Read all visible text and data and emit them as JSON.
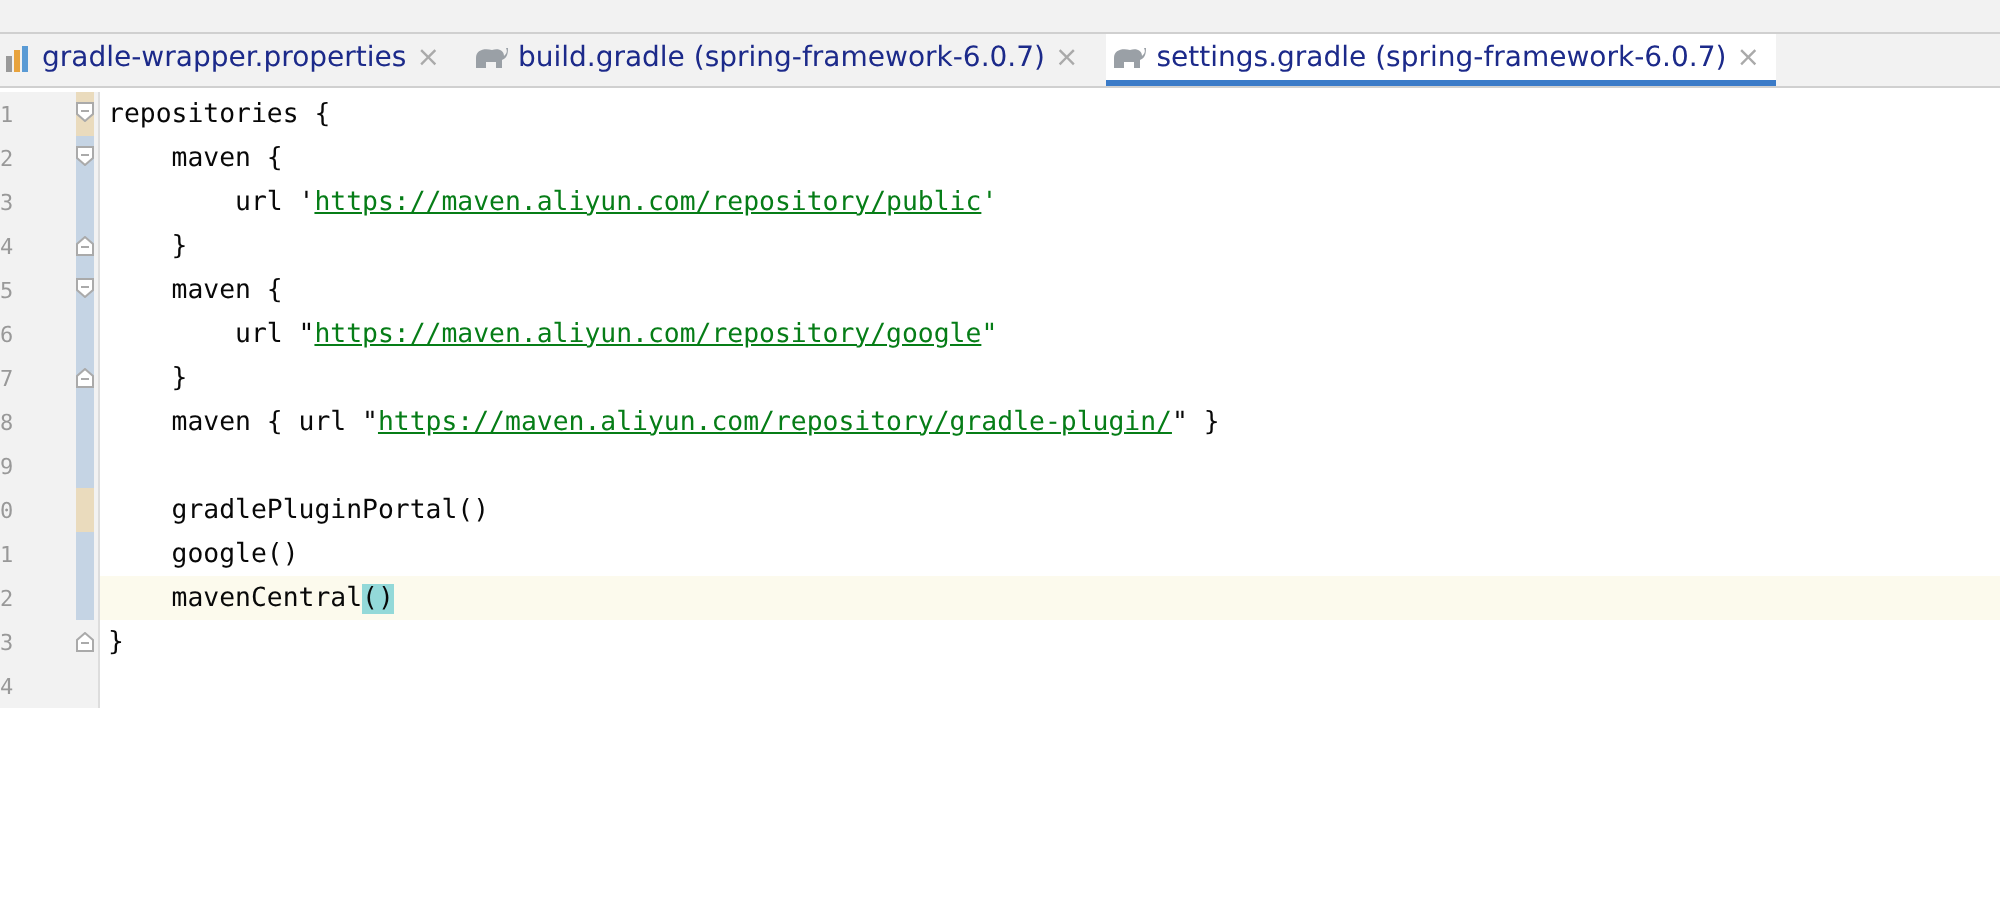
{
  "tabs": [
    {
      "label": "gradle-wrapper.properties",
      "kind": "properties",
      "selected": false,
      "close": "×"
    },
    {
      "label": "build.gradle (spring-framework-6.0.7)",
      "kind": "gradle",
      "selected": false,
      "close": "×"
    },
    {
      "label": "settings.gradle (spring-framework-6.0.7)",
      "kind": "gradle",
      "selected": true,
      "close": "×"
    }
  ],
  "lines": [
    {
      "number": "1",
      "added": true,
      "modified": false,
      "fold_start": true,
      "fold_end": false,
      "current": false,
      "segments": [
        {
          "kind": "code",
          "text": "repositories {"
        }
      ]
    },
    {
      "number": "2",
      "added": false,
      "modified": true,
      "fold_start": true,
      "fold_end": false,
      "current": false,
      "segments": [
        {
          "kind": "code",
          "text": "    maven {"
        }
      ]
    },
    {
      "number": "3",
      "added": false,
      "modified": true,
      "fold_start": false,
      "fold_end": false,
      "current": false,
      "segments": [
        {
          "kind": "code",
          "text": "        url '"
        },
        {
          "kind": "url",
          "text": "https://maven.aliyun.com/repository/public"
        },
        {
          "kind": "string",
          "text": "'"
        }
      ]
    },
    {
      "number": "4",
      "added": false,
      "modified": true,
      "fold_start": false,
      "fold_end": true,
      "current": false,
      "segments": [
        {
          "kind": "code",
          "text": "    }"
        }
      ]
    },
    {
      "number": "5",
      "added": false,
      "modified": true,
      "fold_start": true,
      "fold_end": false,
      "current": false,
      "segments": [
        {
          "kind": "code",
          "text": "    maven {"
        }
      ]
    },
    {
      "number": "6",
      "added": false,
      "modified": true,
      "fold_start": false,
      "fold_end": false,
      "current": false,
      "segments": [
        {
          "kind": "code",
          "text": "        url \""
        },
        {
          "kind": "url",
          "text": "https://maven.aliyun.com/repository/google"
        },
        {
          "kind": "string",
          "text": "\""
        }
      ]
    },
    {
      "number": "7",
      "added": false,
      "modified": true,
      "fold_start": false,
      "fold_end": true,
      "current": false,
      "segments": [
        {
          "kind": "code",
          "text": "    }"
        }
      ]
    },
    {
      "number": "8",
      "added": false,
      "modified": true,
      "fold_start": false,
      "fold_end": false,
      "current": false,
      "segments": [
        {
          "kind": "code",
          "text": "    maven { url \""
        },
        {
          "kind": "url",
          "text": "https://maven.aliyun.com/repository/gradle-plugin/"
        },
        {
          "kind": "code",
          "text": "\" }"
        }
      ]
    },
    {
      "number": "9",
      "added": false,
      "modified": true,
      "fold_start": false,
      "fold_end": false,
      "current": false
    },
    {
      "number": "0",
      "added": true,
      "modified": false,
      "fold_start": false,
      "fold_end": false,
      "current": false,
      "segments": [
        {
          "kind": "code",
          "text": "    gradlePluginPortal()"
        }
      ]
    },
    {
      "number": "1",
      "added": false,
      "modified": true,
      "fold_start": false,
      "fold_end": false,
      "current": false,
      "segments": [
        {
          "kind": "code",
          "text": "    google()"
        }
      ]
    },
    {
      "number": "2",
      "added": false,
      "modified": true,
      "fold_start": false,
      "fold_end": false,
      "current": true,
      "segments": [
        {
          "kind": "code",
          "text": "    mavenCentral"
        },
        {
          "kind": "bracket",
          "text": "()"
        }
      ]
    },
    {
      "number": "3",
      "added": false,
      "modified": false,
      "fold_start": false,
      "fold_end": true,
      "current": false,
      "segments": [
        {
          "kind": "code",
          "text": "}"
        }
      ]
    },
    {
      "number": "4",
      "added": false,
      "modified": false,
      "fold_start": false,
      "fold_end": false,
      "current": false
    }
  ]
}
